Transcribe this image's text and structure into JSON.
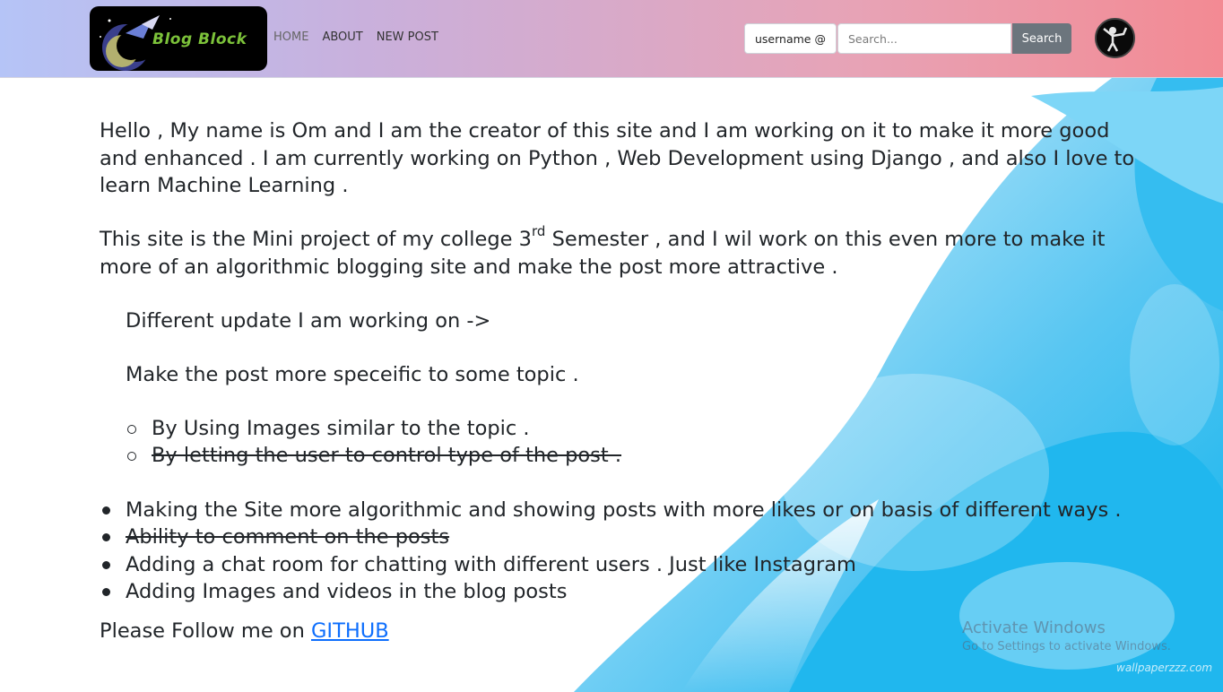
{
  "navbar": {
    "brand_text": "Blog Block",
    "links": [
      "HOME",
      "ABOUT",
      "NEW POST"
    ],
    "username_label": "username @",
    "search_placeholder": "Search...",
    "search_button": "Search"
  },
  "content": {
    "para1": "Hello , My name is Om and I am the creator of this site and I am working on it to make it more good and enhanced . I am currently working on Python , Web Development using Django , and also I love to learn Machine Learning .",
    "para2_before": "This site is the Mini project of my college 3",
    "para2_sup": "rd",
    "para2_after": " Semester , and I wil work on this even more to make it more of an algorithmic blogging site and make the post more attractive .",
    "updates_heading": "Different update I am working on ->",
    "updates_sub": "Make the post more speceific to some topic .",
    "sub_items": [
      "By Using Images similar to the topic .",
      "By letting the user to control type of the post ."
    ],
    "main_items": [
      "Making the Site more algorithmic and showing posts with more likes or on basis of different ways .",
      "Ability to comment on the posts",
      "Adding a chat room for chatting with different users . Just like Instagram",
      "Adding Images and videos in the blog posts"
    ],
    "follow_text": "Please Follow me on ",
    "follow_link": "GITHUB"
  },
  "overlay": {
    "activate_title": "Activate Windows",
    "activate_sub": "Go to Settings to activate Windows.",
    "watermark": "wallpaperzzz.com"
  },
  "colors": {
    "nav_gradient_start": "#b5c4f7",
    "nav_gradient_end": "#f38a93",
    "link_blue": "#0d6efd",
    "search_button": "#6c757d",
    "background_cyan": "#15b8ee"
  }
}
